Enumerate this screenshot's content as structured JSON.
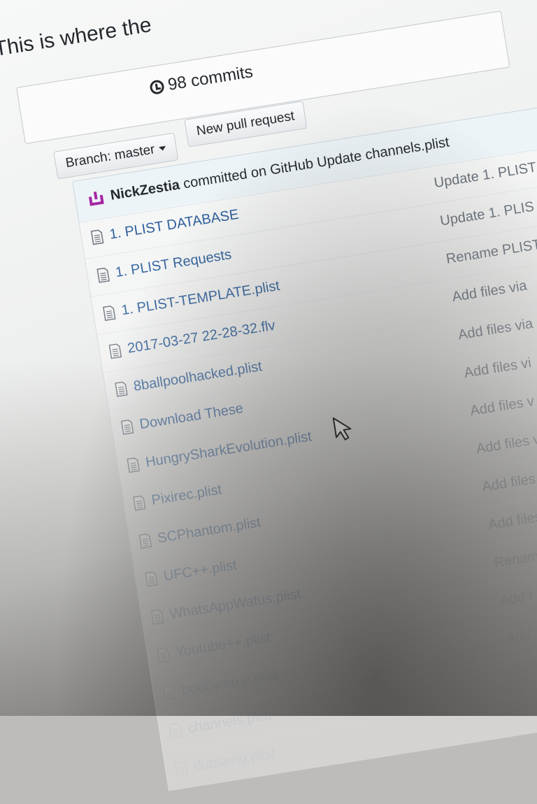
{
  "intro_text": "This is where the",
  "summary": {
    "commits_label": "98 commits"
  },
  "controls": {
    "branch_label": "Branch: master",
    "new_pr_label": "New pull request"
  },
  "latest_commit": {
    "author": "NickZestia",
    "text": "committed on GitHub Update channels.plist"
  },
  "files": [
    {
      "name": "1. PLIST DATABASE",
      "message": "Update 1. PLIST"
    },
    {
      "name": "1. PLIST Requests",
      "message": "Update 1. PLIS"
    },
    {
      "name": "1. PLIST-TEMPLATE.plist",
      "message": "Rename PLIST"
    },
    {
      "name": "2017-03-27 22-28-32.flv",
      "message": "Add files via"
    },
    {
      "name": "8ballpoolhacked.plist",
      "message": "Add files via"
    },
    {
      "name": "Download These",
      "message": "Add files vi"
    },
    {
      "name": "HungrySharkEvolution.plist",
      "message": "Add files v"
    },
    {
      "name": "Pixirec.plist",
      "message": "Add files v"
    },
    {
      "name": "SCPhantom.plist",
      "message": "Add files"
    },
    {
      "name": "UFC++.plist",
      "message": "Add files"
    },
    {
      "name": "WhatsAppWatus.plist",
      "message": "Rename"
    },
    {
      "name": "Youtube++.plist",
      "message": "Add f"
    },
    {
      "name": "bobbymo.e.plist",
      "message": "Add"
    },
    {
      "name": "channels.plist",
      "message": ""
    },
    {
      "name": "dubseng.plist",
      "message": ""
    }
  ],
  "colors": {
    "link": "#2e5f9c",
    "muted": "#6a737d",
    "avatar": "#a626a4"
  },
  "icons": {
    "history": "history-icon",
    "file": "file-icon",
    "cursor": "mouse-pointer-icon",
    "avatar": "avatar-icon"
  }
}
